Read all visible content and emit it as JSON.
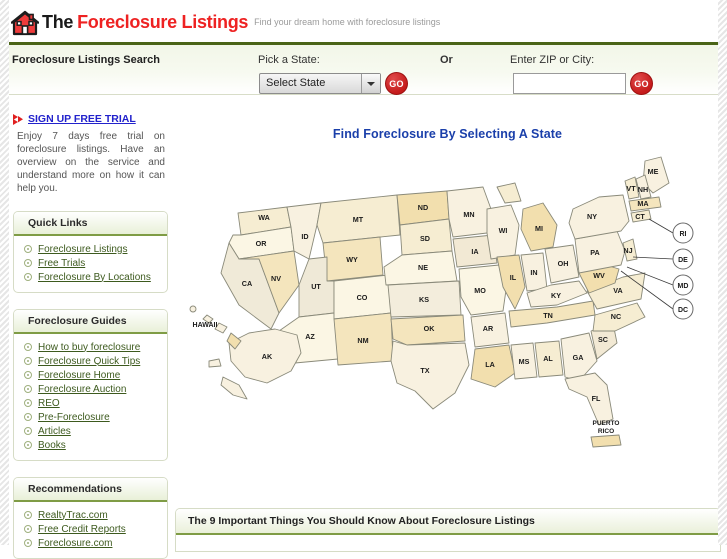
{
  "header": {
    "logo_icon": "house-icon",
    "brand_the": "The",
    "brand_name": "Foreclosure Listings",
    "tagline": "Find your dream home with foreclosure listings"
  },
  "search": {
    "title": "Foreclosure Listings Search",
    "pick_state_label": "Pick a State:",
    "state_selected": "Select State",
    "or_label": "Or",
    "zip_label": "Enter ZIP or City:",
    "zip_value": "",
    "zip_placeholder": "",
    "go_label": "GO",
    "dropdown_icon": "chevron-down-icon"
  },
  "sidebar": {
    "signup": {
      "bullet_icon": "red-arrow-bullet-icon",
      "link": "SIGN UP FREE TRIAL",
      "body": "Enjoy 7 days free trial on foreclosure listings. Have an overview on the service and understand more on how it can help you."
    },
    "panels": [
      {
        "title": "Quick Links",
        "items": [
          "Foreclosure Listings",
          "Free Trials",
          "Foreclosure By Locations"
        ]
      },
      {
        "title": "Foreclosure Guides",
        "items": [
          "How to buy foreclosure",
          "Foreclosure Quick Tips",
          "Foreclosure Home",
          "Foreclosure Auction",
          "REO",
          "Pre-Foreclosure",
          "Articles",
          "Books"
        ]
      },
      {
        "title": "Recommendations",
        "items": [
          "RealtyTrac.com",
          "Free Credit Reports",
          "Foreclosure.com"
        ]
      }
    ],
    "bullet_icon": "circle-bullet-icon"
  },
  "main": {
    "map_title": "Find Foreclosure By Selecting A State",
    "map": {
      "hawaii_label": "HAWAII",
      "puerto_rico_label": "PUERTO RICO",
      "states": [
        "WA",
        "OR",
        "CA",
        "NV",
        "ID",
        "MT",
        "WY",
        "UT",
        "AZ",
        "CO",
        "NM",
        "ND",
        "SD",
        "NE",
        "KS",
        "OK",
        "TX",
        "MN",
        "IA",
        "MO",
        "AR",
        "LA",
        "WI",
        "IL",
        "MS",
        "AL",
        "MI",
        "IN",
        "KY",
        "TN",
        "GA",
        "FL",
        "SC",
        "NC",
        "VA",
        "WV",
        "OH",
        "PA",
        "NY",
        "ME",
        "VT",
        "NH",
        "MA",
        "CT",
        "NJ",
        "AK"
      ],
      "callouts": [
        "RI",
        "DE",
        "MD",
        "DC"
      ]
    }
  },
  "bottom": {
    "title": "The 9 Important Things You Should Know About Foreclosure Listings"
  },
  "colors": {
    "brand_red": "#ee2222",
    "header_rule_green": "#4a6417",
    "panel_border": "#d6dcc6",
    "panel_rule": "#7f9c45",
    "link_green": "#3d5a1e",
    "link_blue": "#2222cc",
    "map_title_blue": "#1a3faa",
    "go_red": "#c51b1b",
    "map_fill_light": "#fbf6e4",
    "map_fill_mid": "#f6edd2",
    "map_fill_dark": "#f2e3b8",
    "map_stroke": "#8a8a7a"
  }
}
